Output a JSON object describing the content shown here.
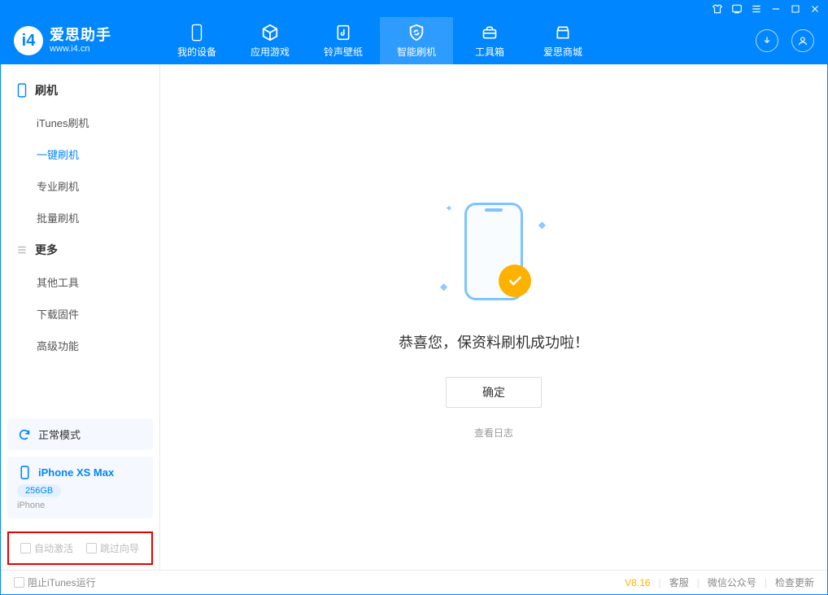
{
  "app": {
    "title": "爱思助手",
    "subtitle": "www.i4.cn"
  },
  "nav": {
    "tabs": [
      {
        "label": "我的设备"
      },
      {
        "label": "应用游戏"
      },
      {
        "label": "铃声壁纸"
      },
      {
        "label": "智能刷机"
      },
      {
        "label": "工具箱"
      },
      {
        "label": "爱思商城"
      }
    ],
    "active_index": 3
  },
  "sidebar": {
    "groups": [
      {
        "title": "刷机",
        "items": [
          {
            "label": "iTunes刷机"
          },
          {
            "label": "一键刷机"
          },
          {
            "label": "专业刷机"
          },
          {
            "label": "批量刷机"
          }
        ],
        "active_index": 1
      },
      {
        "title": "更多",
        "items": [
          {
            "label": "其他工具"
          },
          {
            "label": "下载固件"
          },
          {
            "label": "高级功能"
          }
        ],
        "active_index": -1
      }
    ],
    "device_mode": "正常模式",
    "device": {
      "name": "iPhone XS Max",
      "capacity": "256GB",
      "type": "iPhone"
    },
    "checkboxes": {
      "auto_activate": "自动激活",
      "skip_guide": "跳过向导"
    }
  },
  "content": {
    "success_message": "恭喜您，保资料刷机成功啦！",
    "ok_button": "确定",
    "view_log": "查看日志"
  },
  "statusbar": {
    "block_itunes": "阻止iTunes运行",
    "version": "V8.16",
    "links": {
      "support": "客服",
      "wechat": "微信公众号",
      "check_update": "检查更新"
    }
  },
  "colors": {
    "primary": "#0086ff",
    "accent": "#ffb100"
  }
}
